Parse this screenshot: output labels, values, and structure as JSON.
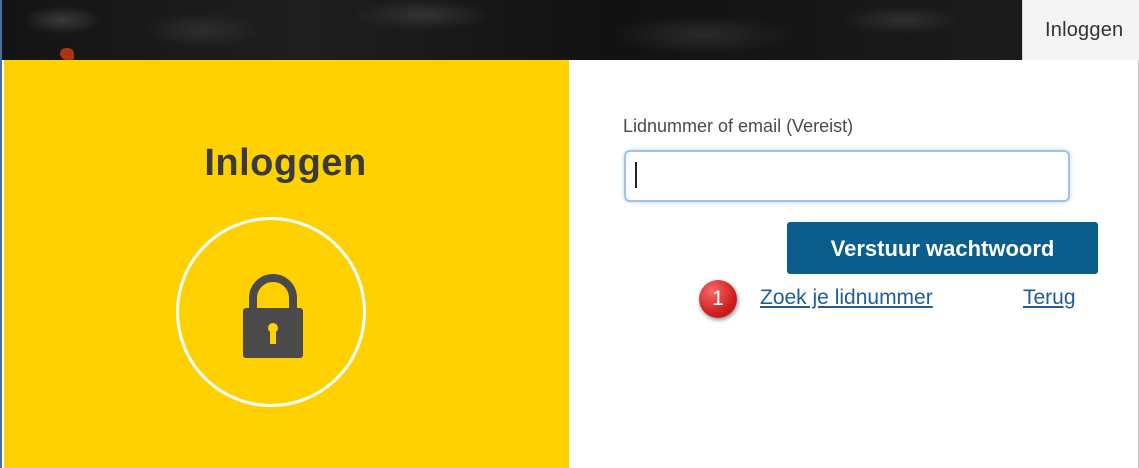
{
  "header": {
    "login_tab": "Inloggen"
  },
  "left_panel": {
    "title": "Inloggen",
    "icon": "lock-icon",
    "background": "#ffd100"
  },
  "form": {
    "field_label": "Lidnummer of email (Vereist)",
    "field_value": "",
    "submit_label": "Verstuur wachtwoord",
    "find_member_link": "Zoek je lidnummer",
    "back_link": "Terug"
  },
  "annotation": {
    "badge_number": "1"
  },
  "colors": {
    "accent_button": "#0b5d8c",
    "link": "#1f5e94",
    "badge": "#d01f1f"
  }
}
